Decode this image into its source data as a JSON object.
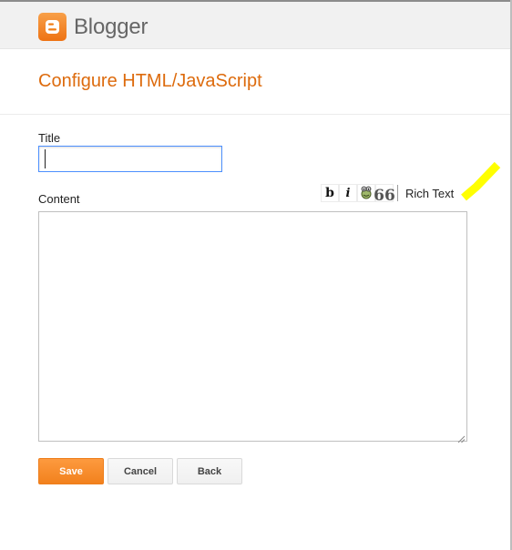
{
  "header": {
    "brand": "Blogger",
    "logo_icon": "blogger-logo-icon",
    "background": "#f1f1f1"
  },
  "page": {
    "title": "Configure HTML/JavaScript",
    "title_color": "#dd6b0d"
  },
  "form": {
    "title_label": "Title",
    "title_value": "",
    "content_label": "Content",
    "content_value": ""
  },
  "toolbar": {
    "bold_label": "b",
    "italic_label": "i",
    "link_icon": "insert-link-icon",
    "quote_label": "66",
    "rich_text_label": "Rich Text"
  },
  "buttons": {
    "save": "Save",
    "cancel": "Cancel",
    "back": "Back",
    "save_color": "#f2811d"
  },
  "annotation": {
    "highlight_color": "#ffff00"
  }
}
